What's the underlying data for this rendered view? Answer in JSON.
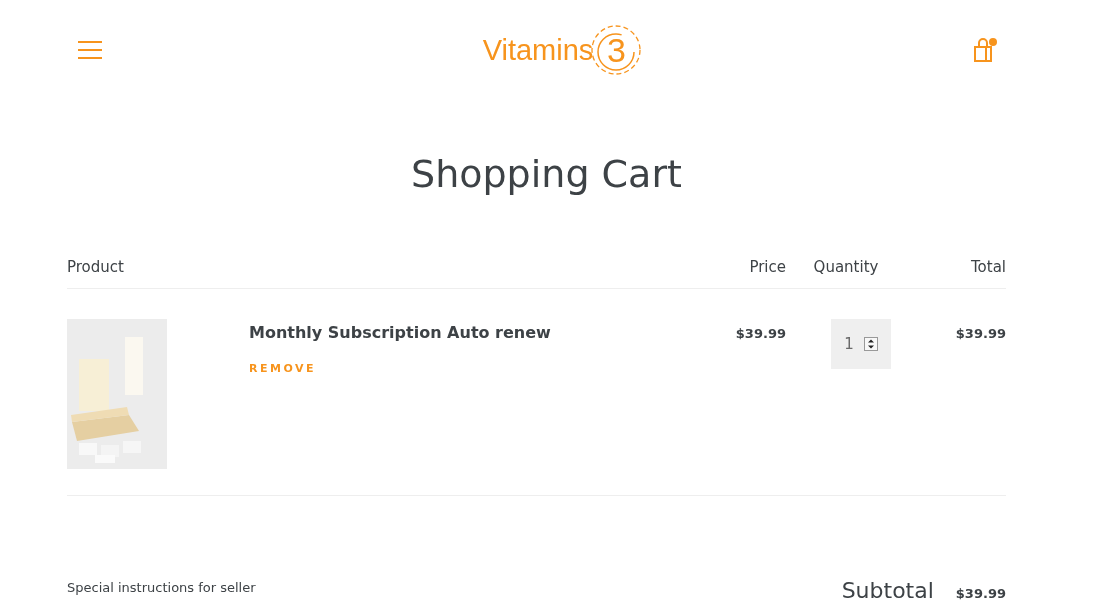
{
  "header": {
    "logo": {
      "word": "Vitamins",
      "digit": "3"
    },
    "cart_has_items": true
  },
  "title": "Shopping Cart",
  "table": {
    "columns": [
      "Product",
      "Price",
      "Quantity",
      "Total"
    ],
    "rows": [
      {
        "name": "Monthly Subscription Auto renew",
        "remove": "REMOVE",
        "price": "$39.99",
        "quantity": "1",
        "total": "$39.99"
      }
    ]
  },
  "footer": {
    "instructions_label": "Special instructions for seller",
    "subtotal_label": "Subtotal",
    "subtotal": "$39.99"
  }
}
